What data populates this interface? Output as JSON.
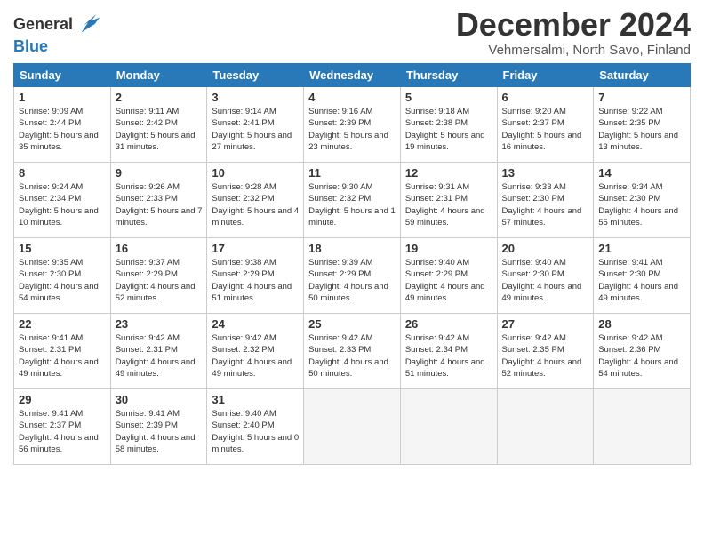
{
  "header": {
    "logo_line1": "General",
    "logo_line2": "Blue",
    "month": "December 2024",
    "location": "Vehmersalmi, North Savo, Finland"
  },
  "days_of_week": [
    "Sunday",
    "Monday",
    "Tuesday",
    "Wednesday",
    "Thursday",
    "Friday",
    "Saturday"
  ],
  "weeks": [
    [
      {
        "day": 1,
        "sunrise": "9:09 AM",
        "sunset": "2:44 PM",
        "daylight": "5 hours and 35 minutes."
      },
      {
        "day": 2,
        "sunrise": "9:11 AM",
        "sunset": "2:42 PM",
        "daylight": "5 hours and 31 minutes."
      },
      {
        "day": 3,
        "sunrise": "9:14 AM",
        "sunset": "2:41 PM",
        "daylight": "5 hours and 27 minutes."
      },
      {
        "day": 4,
        "sunrise": "9:16 AM",
        "sunset": "2:39 PM",
        "daylight": "5 hours and 23 minutes."
      },
      {
        "day": 5,
        "sunrise": "9:18 AM",
        "sunset": "2:38 PM",
        "daylight": "5 hours and 19 minutes."
      },
      {
        "day": 6,
        "sunrise": "9:20 AM",
        "sunset": "2:37 PM",
        "daylight": "5 hours and 16 minutes."
      },
      {
        "day": 7,
        "sunrise": "9:22 AM",
        "sunset": "2:35 PM",
        "daylight": "5 hours and 13 minutes."
      }
    ],
    [
      {
        "day": 8,
        "sunrise": "9:24 AM",
        "sunset": "2:34 PM",
        "daylight": "5 hours and 10 minutes."
      },
      {
        "day": 9,
        "sunrise": "9:26 AM",
        "sunset": "2:33 PM",
        "daylight": "5 hours and 7 minutes."
      },
      {
        "day": 10,
        "sunrise": "9:28 AM",
        "sunset": "2:32 PM",
        "daylight": "5 hours and 4 minutes."
      },
      {
        "day": 11,
        "sunrise": "9:30 AM",
        "sunset": "2:32 PM",
        "daylight": "5 hours and 1 minute."
      },
      {
        "day": 12,
        "sunrise": "9:31 AM",
        "sunset": "2:31 PM",
        "daylight": "4 hours and 59 minutes."
      },
      {
        "day": 13,
        "sunrise": "9:33 AM",
        "sunset": "2:30 PM",
        "daylight": "4 hours and 57 minutes."
      },
      {
        "day": 14,
        "sunrise": "9:34 AM",
        "sunset": "2:30 PM",
        "daylight": "4 hours and 55 minutes."
      }
    ],
    [
      {
        "day": 15,
        "sunrise": "9:35 AM",
        "sunset": "2:30 PM",
        "daylight": "4 hours and 54 minutes."
      },
      {
        "day": 16,
        "sunrise": "9:37 AM",
        "sunset": "2:29 PM",
        "daylight": "4 hours and 52 minutes."
      },
      {
        "day": 17,
        "sunrise": "9:38 AM",
        "sunset": "2:29 PM",
        "daylight": "4 hours and 51 minutes."
      },
      {
        "day": 18,
        "sunrise": "9:39 AM",
        "sunset": "2:29 PM",
        "daylight": "4 hours and 50 minutes."
      },
      {
        "day": 19,
        "sunrise": "9:40 AM",
        "sunset": "2:29 PM",
        "daylight": "4 hours and 49 minutes."
      },
      {
        "day": 20,
        "sunrise": "9:40 AM",
        "sunset": "2:30 PM",
        "daylight": "4 hours and 49 minutes."
      },
      {
        "day": 21,
        "sunrise": "9:41 AM",
        "sunset": "2:30 PM",
        "daylight": "4 hours and 49 minutes."
      }
    ],
    [
      {
        "day": 22,
        "sunrise": "9:41 AM",
        "sunset": "2:31 PM",
        "daylight": "4 hours and 49 minutes."
      },
      {
        "day": 23,
        "sunrise": "9:42 AM",
        "sunset": "2:31 PM",
        "daylight": "4 hours and 49 minutes."
      },
      {
        "day": 24,
        "sunrise": "9:42 AM",
        "sunset": "2:32 PM",
        "daylight": "4 hours and 49 minutes."
      },
      {
        "day": 25,
        "sunrise": "9:42 AM",
        "sunset": "2:33 PM",
        "daylight": "4 hours and 50 minutes."
      },
      {
        "day": 26,
        "sunrise": "9:42 AM",
        "sunset": "2:34 PM",
        "daylight": "4 hours and 51 minutes."
      },
      {
        "day": 27,
        "sunrise": "9:42 AM",
        "sunset": "2:35 PM",
        "daylight": "4 hours and 52 minutes."
      },
      {
        "day": 28,
        "sunrise": "9:42 AM",
        "sunset": "2:36 PM",
        "daylight": "4 hours and 54 minutes."
      }
    ],
    [
      {
        "day": 29,
        "sunrise": "9:41 AM",
        "sunset": "2:37 PM",
        "daylight": "4 hours and 56 minutes."
      },
      {
        "day": 30,
        "sunrise": "9:41 AM",
        "sunset": "2:39 PM",
        "daylight": "4 hours and 58 minutes."
      },
      {
        "day": 31,
        "sunrise": "9:40 AM",
        "sunset": "2:40 PM",
        "daylight": "5 hours and 0 minutes."
      },
      null,
      null,
      null,
      null
    ]
  ],
  "labels": {
    "sunrise": "Sunrise:",
    "sunset": "Sunset:",
    "daylight": "Daylight:"
  }
}
